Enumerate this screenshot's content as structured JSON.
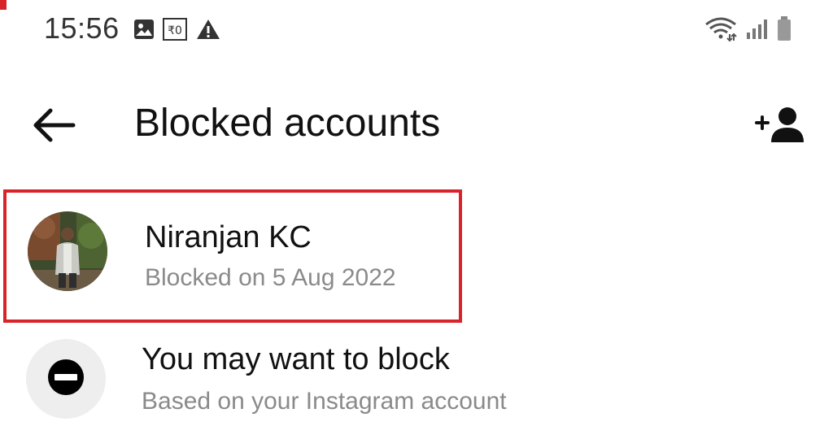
{
  "status_bar": {
    "time": "15:56",
    "left_icons": [
      "image-icon",
      "rupee-icon",
      "warning-icon"
    ],
    "right_icons": [
      "wifi-icon",
      "signal-icon",
      "battery-icon"
    ]
  },
  "app_bar": {
    "title": "Blocked accounts",
    "back_icon": "arrow-left-icon",
    "action_icon": "add-person-icon"
  },
  "blocked_accounts": [
    {
      "name": "Niranjan KC",
      "subtitle": "Blocked on 5 Aug 2022"
    }
  ],
  "suggestion": {
    "title": "You may want to block",
    "subtitle": "Based on your Instagram account",
    "icon": "block-icon"
  },
  "colors": {
    "highlight": "#d8232a",
    "text_primary": "#111111",
    "text_secondary": "#8a8a8a"
  }
}
